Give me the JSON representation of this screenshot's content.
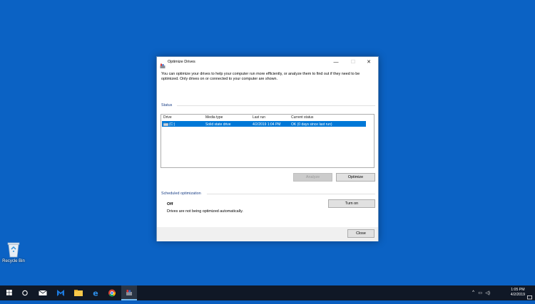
{
  "desktop": {
    "recycle_bin_label": "Recycle Bin"
  },
  "window": {
    "title": "Optimize Drives",
    "description": "You can optimize your drives to help your computer run more efficiently, or analyze them to find out if they need to be optimized. Only drives on or connected to your computer are shown.",
    "status_title": "Status",
    "columns": [
      "Drive",
      "Media type",
      "Last run",
      "Current status"
    ],
    "rows": [
      {
        "drive": "(C:)",
        "media_type": "Solid state drive",
        "last_run": "4/2/2019 1:04 PM",
        "current_status": "OK (0 days since last run)",
        "selected": true
      }
    ],
    "analyze_label": "Analyze",
    "optimize_label": "Optimize",
    "scheduled_title": "Scheduled optimization",
    "scheduled_state": "Off",
    "scheduled_desc": "Drives are not being optimized automatically.",
    "turn_on_label": "Turn on",
    "close_label": "Close"
  },
  "taskbar": {
    "time": "1:05 PM",
    "date": "4/2/2019",
    "icons": [
      "windows-start-icon",
      "search-circle-icon",
      "mail-icon",
      "malwarebytes-icon",
      "file-explorer-icon",
      "edge-icon",
      "chrome-icon",
      "optimize-drives-icon"
    ]
  },
  "colors": {
    "desktop": "#0b62c4",
    "selection": "#0078d7",
    "taskbar": "#101826",
    "group_title": "#1a3f86"
  }
}
